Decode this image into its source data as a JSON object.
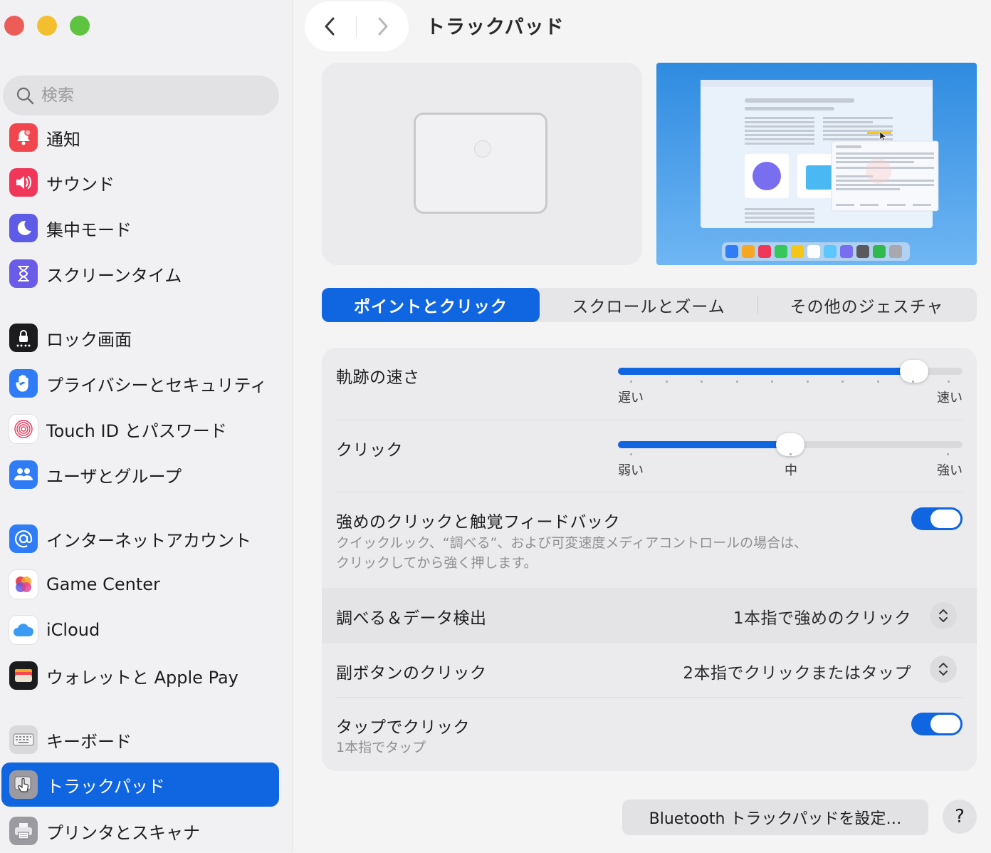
{
  "window": {
    "title": "トラックパッド"
  },
  "sidebar": {
    "search_placeholder": "検索",
    "items": [
      {
        "label": "通知",
        "icon": "bell-icon",
        "color": "#f2464f"
      },
      {
        "label": "サウンド",
        "icon": "speaker-icon",
        "color": "#f0375a"
      },
      {
        "label": "集中モード",
        "icon": "moon-icon",
        "color": "#5e5ce6"
      },
      {
        "label": "スクリーンタイム",
        "icon": "hourglass-icon",
        "color": "#6b5ce8"
      },
      {
        "label": "ロック画面",
        "icon": "lock-icon",
        "color": "#1c1c1e"
      },
      {
        "label": "プライバシーとセキュリティ",
        "icon": "hand-icon",
        "color": "#2f7cf6"
      },
      {
        "label": "Touch ID とパスワード",
        "icon": "fingerprint-icon",
        "color": "#ffffff"
      },
      {
        "label": "ユーザとグループ",
        "icon": "users-icon",
        "color": "#2f7cf6"
      },
      {
        "label": "インターネットアカウント",
        "icon": "at-icon",
        "color": "#2f7cf6"
      },
      {
        "label": "Game Center",
        "icon": "game-center-icon",
        "color": "#ffffff"
      },
      {
        "label": "iCloud",
        "icon": "cloud-icon",
        "color": "#ffffff"
      },
      {
        "label": "ウォレットと Apple Pay",
        "icon": "wallet-icon",
        "color": "#1c1c1e"
      },
      {
        "label": "キーボード",
        "icon": "keyboard-icon",
        "color": "#d9d9dc"
      },
      {
        "label": "トラックパッド",
        "icon": "trackpad-icon",
        "color": "#9a9aa0",
        "selected": true
      },
      {
        "label": "プリンタとスキャナ",
        "icon": "printer-icon",
        "color": "#9a9aa0"
      }
    ]
  },
  "tabs": [
    {
      "label": "ポイントとクリック",
      "active": true
    },
    {
      "label": "スクロールとズーム",
      "active": false
    },
    {
      "label": "その他のジェスチャ",
      "active": false
    }
  ],
  "settings": {
    "tracking": {
      "label": "軌跡の速さ",
      "value": 0.86,
      "min_label": "遅い",
      "max_label": "速い"
    },
    "click": {
      "label": "クリック",
      "value": 0.5,
      "min_label": "弱い",
      "mid_label": "中",
      "max_label": "強い"
    },
    "force_click": {
      "label": "強めのクリックと触覚フィードバック",
      "desc_line1": "クイックルック、“調べる”、および可変速度メディアコントロールの場合は、",
      "desc_line2": "クリックしてから強く押します。",
      "on": true
    },
    "lookup": {
      "label": "調べる＆データ検出",
      "value": "1本指で強めのクリック"
    },
    "secondary_click": {
      "label": "副ボタンのクリック",
      "value": "2本指でクリックまたはタップ"
    },
    "tap_to_click": {
      "label": "タップでクリック",
      "sub": "1本指でタップ",
      "on": true
    }
  },
  "footer": {
    "bluetooth_button": "Bluetooth トラックパッドを設定…",
    "help_button": "?"
  },
  "colors": {
    "accent": "#1065e0"
  }
}
